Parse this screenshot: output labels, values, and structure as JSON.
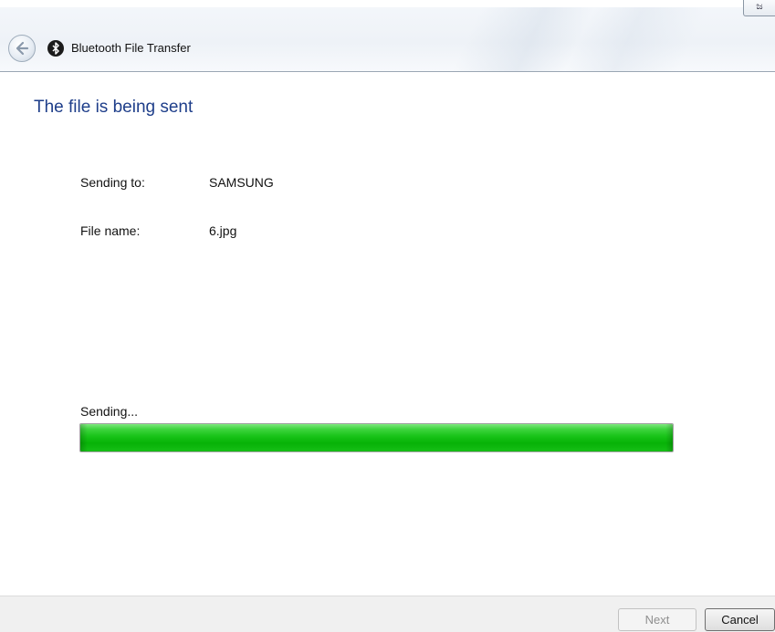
{
  "window": {
    "title": "Bluetooth File Transfer",
    "corner_button_label": "ಜ"
  },
  "heading": "The file is being sent",
  "details": [
    {
      "label": "Sending to:",
      "value": "SAMSUNG"
    },
    {
      "label": "File name:",
      "value": "6.jpg"
    }
  ],
  "progress": {
    "label": "Sending...",
    "percent": 100,
    "color": "#17c317"
  },
  "footer": {
    "next_label": "Next",
    "next_enabled": false,
    "cancel_label": "Cancel"
  },
  "icons": {
    "back": "back-arrow-icon",
    "app": "bluetooth-icon"
  },
  "colors": {
    "heading": "#1e3e8a",
    "footer_bg": "#f0f0f0"
  }
}
